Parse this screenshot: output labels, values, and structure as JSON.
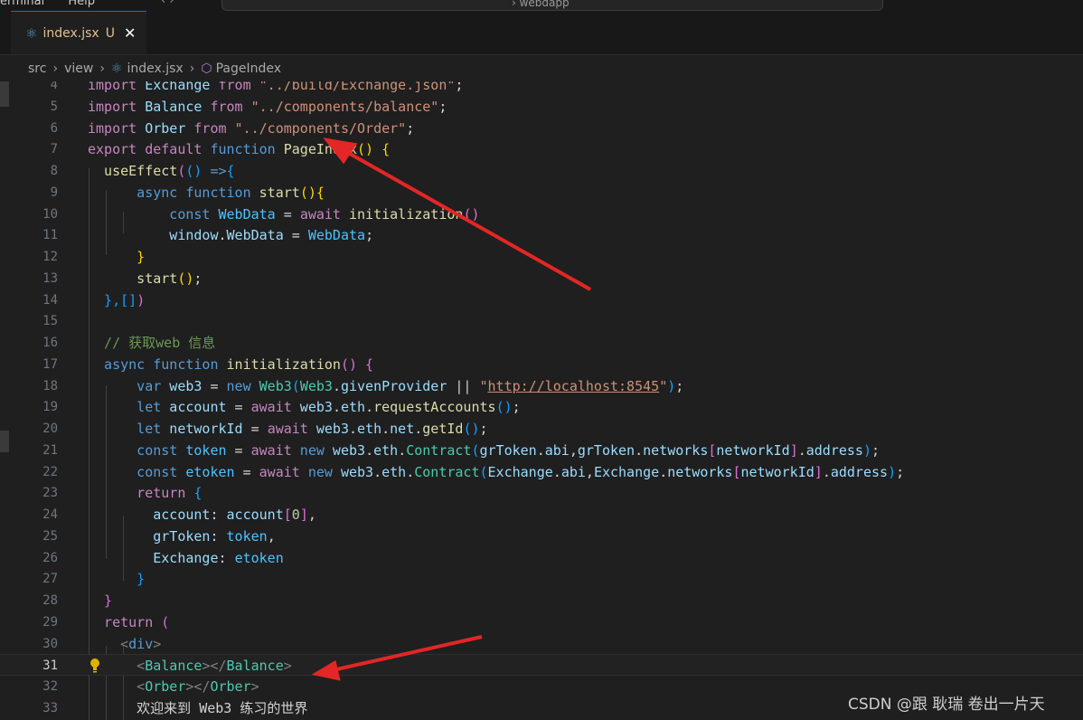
{
  "titlebar": {
    "menu": [
      "erminal",
      "Help"
    ],
    "nav": "‹ ›",
    "search": "› webdapp"
  },
  "tab": {
    "filename": "index.jsx",
    "modified_badge": "U",
    "close_glyph": "✕",
    "icon": "react-icon"
  },
  "breadcrumb": [
    "src",
    "view",
    "index.jsx",
    "PageIndex"
  ],
  "editor": {
    "current_line": "31",
    "lines": [
      {
        "n": "4",
        "tokens": [
          [
            "import",
            "#c586c0"
          ],
          [
            " Exchange ",
            "#9cdcfe"
          ],
          [
            "from",
            "#c586c0"
          ],
          [
            " \"../build/Exchange.json\"",
            "#ce9178"
          ],
          [
            ";",
            "#d4d4d4"
          ]
        ]
      },
      {
        "n": "5",
        "tokens": [
          [
            "import",
            "#c586c0"
          ],
          [
            " Balance ",
            "#9cdcfe"
          ],
          [
            "from",
            "#c586c0"
          ],
          [
            " \"../components/balance\"",
            "#ce9178"
          ],
          [
            ";",
            "#d4d4d4"
          ]
        ]
      },
      {
        "n": "6",
        "tokens": [
          [
            "import",
            "#c586c0"
          ],
          [
            " Orber ",
            "#9cdcfe"
          ],
          [
            "from",
            "#c586c0"
          ],
          [
            " \"../components/Order\"",
            "#ce9178"
          ],
          [
            ";",
            "#d4d4d4"
          ]
        ]
      },
      {
        "n": "7",
        "tokens": [
          [
            "export",
            "#c586c0"
          ],
          [
            " default",
            "#c586c0"
          ],
          [
            " function",
            "#569cd6"
          ],
          [
            " PageIndex",
            "#dcdcaa"
          ],
          [
            "()",
            "#ffd700"
          ],
          [
            " {",
            "#ffd700"
          ]
        ]
      },
      {
        "n": "8",
        "tokens": [
          [
            "  useEffect",
            "#dcdcaa"
          ],
          [
            "(",
            "#da70d6"
          ],
          [
            "()",
            "#179fff"
          ],
          [
            " =>",
            "#569cd6"
          ],
          [
            "{",
            "#179fff"
          ]
        ]
      },
      {
        "n": "9",
        "tokens": [
          [
            "      async",
            "#569cd6"
          ],
          [
            " function",
            "#569cd6"
          ],
          [
            " start",
            "#dcdcaa"
          ],
          [
            "(){",
            "#ffd700"
          ]
        ]
      },
      {
        "n": "10",
        "tokens": [
          [
            "          const",
            "#569cd6"
          ],
          [
            " WebData",
            "#4fc1ff"
          ],
          [
            " = ",
            "#d4d4d4"
          ],
          [
            "await",
            "#c586c0"
          ],
          [
            " initialization",
            "#dcdcaa"
          ],
          [
            "()",
            "#da70d6"
          ]
        ]
      },
      {
        "n": "11",
        "tokens": [
          [
            "          window",
            "#9cdcfe"
          ],
          [
            ".",
            "#d4d4d4"
          ],
          [
            "WebData",
            "#9cdcfe"
          ],
          [
            " = ",
            "#d4d4d4"
          ],
          [
            "WebData",
            "#4fc1ff"
          ],
          [
            ";",
            "#d4d4d4"
          ]
        ]
      },
      {
        "n": "12",
        "tokens": [
          [
            "      }",
            "#ffd700"
          ]
        ]
      },
      {
        "n": "13",
        "tokens": [
          [
            "      start",
            "#dcdcaa"
          ],
          [
            "()",
            "#ffd700"
          ],
          [
            ";",
            "#d4d4d4"
          ]
        ]
      },
      {
        "n": "14",
        "tokens": [
          [
            "  },",
            "#179fff"
          ],
          [
            "[]",
            "#179fff"
          ],
          [
            ")",
            "#da70d6"
          ]
        ]
      },
      {
        "n": "15",
        "tokens": []
      },
      {
        "n": "16",
        "tokens": [
          [
            "  // 获取web 信息",
            "#6a9955"
          ]
        ]
      },
      {
        "n": "17",
        "tokens": [
          [
            "  async",
            "#569cd6"
          ],
          [
            " function",
            "#569cd6"
          ],
          [
            " initialization",
            "#dcdcaa"
          ],
          [
            "()",
            "#da70d6"
          ],
          [
            " {",
            "#da70d6"
          ]
        ]
      },
      {
        "n": "18",
        "tokens": [
          [
            "      var",
            "#569cd6"
          ],
          [
            " web3",
            "#9cdcfe"
          ],
          [
            " = ",
            "#d4d4d4"
          ],
          [
            "new",
            "#569cd6"
          ],
          [
            " Web3",
            "#4ec9b0"
          ],
          [
            "(",
            "#179fff"
          ],
          [
            "Web3",
            "#4ec9b0"
          ],
          [
            ".",
            "#d4d4d4"
          ],
          [
            "givenProvider",
            "#9cdcfe"
          ],
          [
            " || ",
            "#d4d4d4"
          ],
          [
            "\"",
            "#ce9178"
          ],
          [
            "http://localhost:8545",
            "#ce9178",
            "u"
          ],
          [
            "\"",
            "#ce9178"
          ],
          [
            ")",
            "#179fff"
          ],
          [
            ";",
            "#d4d4d4"
          ]
        ]
      },
      {
        "n": "19",
        "tokens": [
          [
            "      let",
            "#569cd6"
          ],
          [
            " account",
            "#9cdcfe"
          ],
          [
            " = ",
            "#d4d4d4"
          ],
          [
            "await",
            "#c586c0"
          ],
          [
            " web3",
            "#9cdcfe"
          ],
          [
            ".",
            "#d4d4d4"
          ],
          [
            "eth",
            "#9cdcfe"
          ],
          [
            ".",
            "#d4d4d4"
          ],
          [
            "requestAccounts",
            "#dcdcaa"
          ],
          [
            "()",
            "#179fff"
          ],
          [
            ";",
            "#d4d4d4"
          ]
        ]
      },
      {
        "n": "20",
        "tokens": [
          [
            "      let",
            "#569cd6"
          ],
          [
            " networkId",
            "#9cdcfe"
          ],
          [
            " = ",
            "#d4d4d4"
          ],
          [
            "await",
            "#c586c0"
          ],
          [
            " web3",
            "#9cdcfe"
          ],
          [
            ".",
            "#d4d4d4"
          ],
          [
            "eth",
            "#9cdcfe"
          ],
          [
            ".",
            "#d4d4d4"
          ],
          [
            "net",
            "#9cdcfe"
          ],
          [
            ".",
            "#d4d4d4"
          ],
          [
            "getId",
            "#dcdcaa"
          ],
          [
            "()",
            "#179fff"
          ],
          [
            ";",
            "#d4d4d4"
          ]
        ]
      },
      {
        "n": "21",
        "tokens": [
          [
            "      const",
            "#569cd6"
          ],
          [
            " token",
            "#4fc1ff"
          ],
          [
            " = ",
            "#d4d4d4"
          ],
          [
            "await",
            "#c586c0"
          ],
          [
            " new",
            "#569cd6"
          ],
          [
            " web3",
            "#9cdcfe"
          ],
          [
            ".",
            "#d4d4d4"
          ],
          [
            "eth",
            "#9cdcfe"
          ],
          [
            ".",
            "#d4d4d4"
          ],
          [
            "Contract",
            "#4ec9b0"
          ],
          [
            "(",
            "#179fff"
          ],
          [
            "grToken",
            "#9cdcfe"
          ],
          [
            ".",
            "#d4d4d4"
          ],
          [
            "abi",
            "#9cdcfe"
          ],
          [
            ",",
            "#d4d4d4"
          ],
          [
            "grToken",
            "#9cdcfe"
          ],
          [
            ".",
            "#d4d4d4"
          ],
          [
            "networks",
            "#9cdcfe"
          ],
          [
            "[",
            "#da70d6"
          ],
          [
            "networkId",
            "#9cdcfe"
          ],
          [
            "]",
            "#da70d6"
          ],
          [
            ".",
            "#d4d4d4"
          ],
          [
            "address",
            "#9cdcfe"
          ],
          [
            ")",
            "#179fff"
          ],
          [
            ";",
            "#d4d4d4"
          ]
        ]
      },
      {
        "n": "22",
        "tokens": [
          [
            "      const",
            "#569cd6"
          ],
          [
            " etoken",
            "#4fc1ff"
          ],
          [
            " = ",
            "#d4d4d4"
          ],
          [
            "await",
            "#c586c0"
          ],
          [
            " new",
            "#569cd6"
          ],
          [
            " web3",
            "#9cdcfe"
          ],
          [
            ".",
            "#d4d4d4"
          ],
          [
            "eth",
            "#9cdcfe"
          ],
          [
            ".",
            "#d4d4d4"
          ],
          [
            "Contract",
            "#4ec9b0"
          ],
          [
            "(",
            "#179fff"
          ],
          [
            "Exchange",
            "#9cdcfe"
          ],
          [
            ".",
            "#d4d4d4"
          ],
          [
            "abi",
            "#9cdcfe"
          ],
          [
            ",",
            "#d4d4d4"
          ],
          [
            "Exchange",
            "#9cdcfe"
          ],
          [
            ".",
            "#d4d4d4"
          ],
          [
            "networks",
            "#9cdcfe"
          ],
          [
            "[",
            "#da70d6"
          ],
          [
            "networkId",
            "#9cdcfe"
          ],
          [
            "]",
            "#da70d6"
          ],
          [
            ".",
            "#d4d4d4"
          ],
          [
            "address",
            "#9cdcfe"
          ],
          [
            ")",
            "#179fff"
          ],
          [
            ";",
            "#d4d4d4"
          ]
        ]
      },
      {
        "n": "23",
        "tokens": [
          [
            "      return",
            "#c586c0"
          ],
          [
            " {",
            "#179fff"
          ]
        ]
      },
      {
        "n": "24",
        "tokens": [
          [
            "        account",
            "#9cdcfe"
          ],
          [
            ": ",
            "#d4d4d4"
          ],
          [
            "account",
            "#9cdcfe"
          ],
          [
            "[",
            "#da70d6"
          ],
          [
            "0",
            "#b5cea8"
          ],
          [
            "]",
            "#da70d6"
          ],
          [
            ",",
            "#d4d4d4"
          ]
        ]
      },
      {
        "n": "25",
        "tokens": [
          [
            "        grToken",
            "#9cdcfe"
          ],
          [
            ": ",
            "#d4d4d4"
          ],
          [
            "token",
            "#4fc1ff"
          ],
          [
            ",",
            "#d4d4d4"
          ]
        ]
      },
      {
        "n": "26",
        "tokens": [
          [
            "        Exchange",
            "#9cdcfe"
          ],
          [
            ": ",
            "#d4d4d4"
          ],
          [
            "etoken",
            "#4fc1ff"
          ]
        ]
      },
      {
        "n": "27",
        "tokens": [
          [
            "      }",
            "#179fff"
          ]
        ]
      },
      {
        "n": "28",
        "tokens": [
          [
            "  }",
            "#da70d6"
          ]
        ]
      },
      {
        "n": "29",
        "tokens": [
          [
            "  return",
            "#c586c0"
          ],
          [
            " (",
            "#da70d6"
          ]
        ]
      },
      {
        "n": "30",
        "tokens": [
          [
            "    <",
            "#808080"
          ],
          [
            "div",
            "#569cd6"
          ],
          [
            ">",
            "#808080"
          ]
        ]
      },
      {
        "n": "31",
        "tokens": [
          [
            "      <",
            "#808080"
          ],
          [
            "Balance",
            "#4ec9b0"
          ],
          [
            ">",
            "#808080"
          ],
          [
            "</",
            "#808080"
          ],
          [
            "Balance",
            "#4ec9b0"
          ],
          [
            ">",
            "#808080"
          ]
        ]
      },
      {
        "n": "32",
        "tokens": [
          [
            "      <",
            "#808080"
          ],
          [
            "Orber",
            "#4ec9b0"
          ],
          [
            "></",
            "#808080"
          ],
          [
            "Orber",
            "#4ec9b0"
          ],
          [
            ">",
            "#808080"
          ]
        ]
      },
      {
        "n": "33",
        "tokens": [
          [
            "      欢迎来到 Web3 练习的世界",
            "#d4d4d4"
          ]
        ]
      }
    ]
  },
  "watermark": "CSDN @跟 耿瑞 卷出一片天",
  "colors": {
    "arrow": "#e32626",
    "accent": "#0078d4",
    "bulb": "#ddb100"
  }
}
